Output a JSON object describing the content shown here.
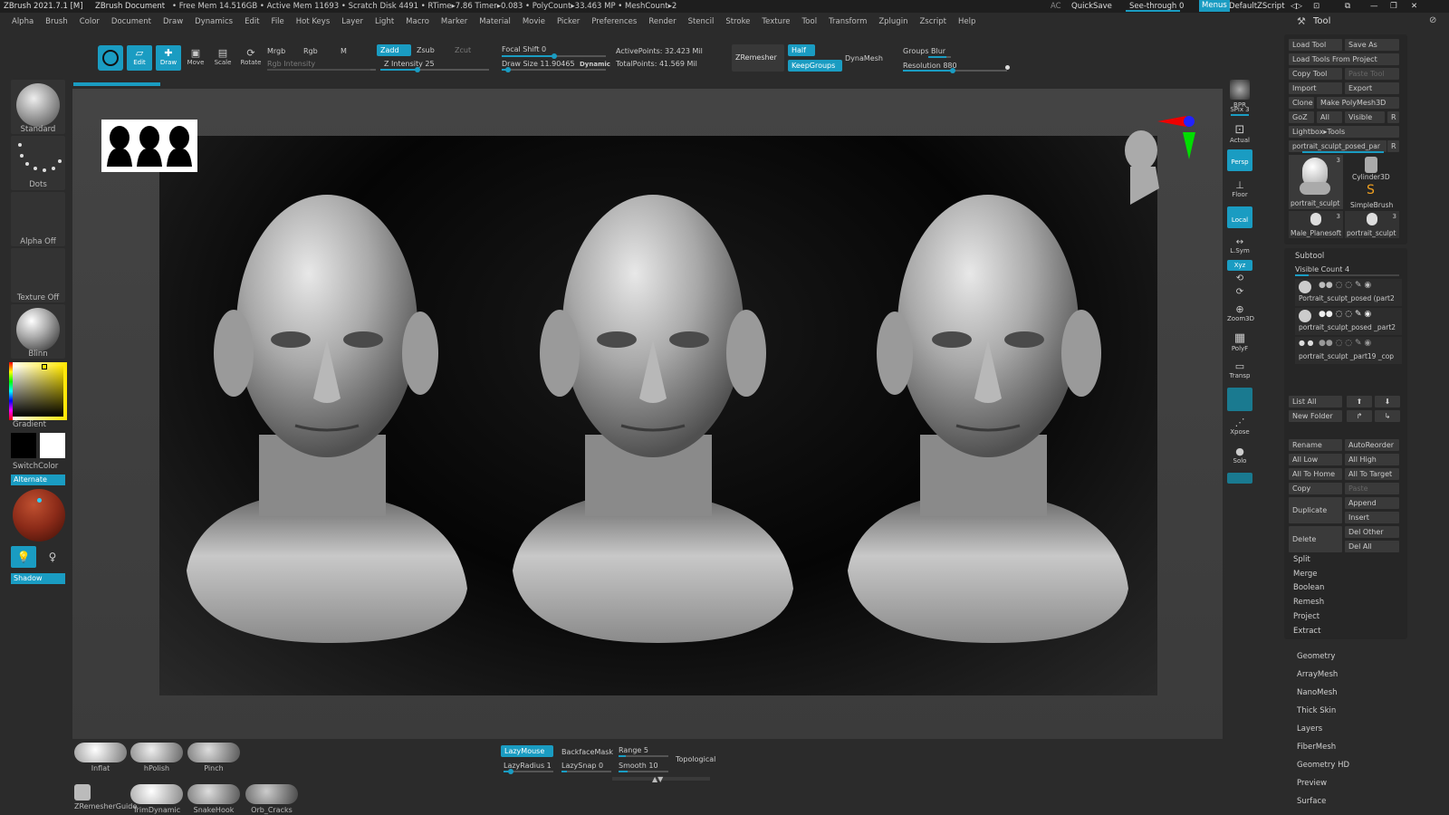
{
  "title": {
    "app": "ZBrush 2021.7.1 [M]",
    "doc": "ZBrush Document",
    "stats": "• Free Mem 14.516GB • Active Mem 11693 • Scratch Disk 4491 • RTime▸7.86 Timer▸0.083 • PolyCount▸33.463 MP • MeshCount▸2",
    "ac": "AC",
    "quicksave": "QuickSave",
    "seethrough": "See-through  0",
    "menus": "Menus",
    "script": "DefaultZScript"
  },
  "menu": [
    "Alpha",
    "Brush",
    "Color",
    "Document",
    "Draw",
    "Dynamics",
    "Edit",
    "File",
    "Hot Keys",
    "Layer",
    "Light",
    "Macro",
    "Marker",
    "Material",
    "Movie",
    "Picker",
    "Preferences",
    "Render",
    "Stencil",
    "Stroke",
    "Texture",
    "Tool",
    "Transform",
    "Zplugin",
    "Zscript",
    "Help"
  ],
  "toolbar": {
    "edit": "Edit",
    "draw": "Draw",
    "move": "Move",
    "scale": "Scale",
    "rotate": "Rotate",
    "mrgb": "Mrgb",
    "rgb": "Rgb",
    "m": "M",
    "rgb_intensity": "Rgb Intensity",
    "zadd": "Zadd",
    "zsub": "Zsub",
    "zcut": "Zcut",
    "z_intensity": "Z Intensity 25",
    "focal_shift": "Focal Shift 0",
    "draw_size": "Draw Size 11.90465",
    "dynamic": "Dynamic",
    "active_points": "ActivePoints: 32.423 Mil",
    "total_points": "TotalPoints: 41.569 Mil",
    "zremesher": "ZRemesher",
    "half": "Half",
    "keepgroups": "KeepGroups",
    "dynamesh": "DynaMesh",
    "groups": "Groups",
    "blur": "Blur",
    "resolution": "Resolution 880"
  },
  "left": {
    "brush": "Standard",
    "stroke": "Dots",
    "alpha": "Alpha Off",
    "texture": "Texture Off",
    "material": "Blinn",
    "gradient": "Gradient",
    "switchcolor": "SwitchColor",
    "alternate": "Alternate",
    "shadow": "Shadow",
    "color_main": "#ffe600",
    "color_black": "#000000",
    "color_white": "#ffffff"
  },
  "right_shelf": [
    "BPR",
    "SPix 3",
    "Actual",
    "Persp",
    "Floor",
    "Local",
    "L.Sym",
    "Xyz",
    "Zoom3D",
    "PolyF",
    "Transp",
    "Xpose",
    "Solo"
  ],
  "tool": {
    "header": "Tool",
    "buttons": [
      "Load Tool",
      "Save As",
      "Load Tools From Project",
      "Copy Tool",
      "Paste Tool",
      "Import",
      "Export",
      "Clone",
      "Make PolyMesh3D",
      "GoZ",
      "All",
      "Visible",
      "R",
      "Lightbox▸Tools",
      "portrait_sculpt_posed_par",
      "R"
    ],
    "thumbs": [
      {
        "label": "portrait_sculpt",
        "count": "3"
      },
      {
        "label": "Cylinder3D",
        "count": ""
      },
      {
        "label": "SimpleBrush",
        "count": ""
      },
      {
        "label": "Male_Planesoft",
        "count": "3"
      },
      {
        "label": "portrait_sculpt",
        "count": "3"
      }
    ]
  },
  "subtool": {
    "header": "Subtool",
    "visible_count": "Visible Count 4",
    "items": [
      "Portrait_sculpt_posed (part2",
      "portrait_sculpt_posed _part2",
      "portrait_sculpt _part19 _cop"
    ],
    "buttons": [
      "List All",
      "New Folder",
      "Rename",
      "AutoReorder",
      "All Low",
      "All High",
      "All To Home",
      "All To Target",
      "Copy",
      "Paste",
      "Duplicate",
      "Append",
      "Insert",
      "Delete",
      "Del Other",
      "Del All"
    ],
    "sections": [
      "Split",
      "Merge",
      "Boolean",
      "Remesh",
      "Project",
      "Extract"
    ]
  },
  "palettes": [
    "Geometry",
    "ArrayMesh",
    "NanoMesh",
    "Thick Skin",
    "Layers",
    "FiberMesh",
    "Geometry HD",
    "Preview",
    "Surface"
  ],
  "bottom": {
    "brushes": [
      "Inflat",
      "hPolish",
      "Pinch"
    ],
    "brushes2": [
      "ZRemesherGuide",
      "TrimDynamic",
      "SnakeHook",
      "Orb_Cracks"
    ],
    "lazymouse": "LazyMouse",
    "backfacemask": "BackfaceMask",
    "range": "Range 5",
    "topological": "Topological",
    "lazyradius": "LazyRadius 1",
    "lazysnap": "LazySnap 0",
    "smooth": "Smooth 10"
  }
}
